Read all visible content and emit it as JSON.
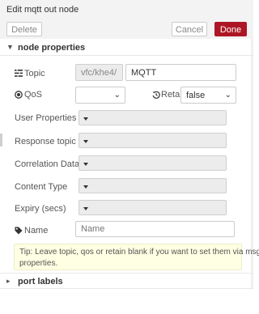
{
  "window": {
    "title": "Edit mqtt out node"
  },
  "toolbar": {
    "delete_label": "Delete",
    "cancel_label": "Cancel",
    "done_label": "Done"
  },
  "sections": {
    "node_properties": "node properties",
    "port_labels": "port labels"
  },
  "form": {
    "topic": {
      "label": "Topic",
      "prefix_value": "vfc/khe4/",
      "value": "MQTT"
    },
    "qos": {
      "label": "QoS",
      "value": ""
    },
    "retain": {
      "label": "Retain",
      "value": "false"
    },
    "user_properties": {
      "label": "User Properties"
    },
    "response_topic": {
      "label": "Response topic"
    },
    "correlation_data": {
      "label": "Correlation Data"
    },
    "content_type": {
      "label": "Content Type"
    },
    "expiry": {
      "label": "Expiry (secs)"
    },
    "name": {
      "label": "Name",
      "placeholder": "Name",
      "value": ""
    }
  },
  "tip": {
    "line1": "Tip: Leave topic, qos or retain blank if you want to set them via msg",
    "line2": "properties."
  },
  "colors": {
    "done_button": "#ad1625",
    "tip_background": "#ffffe3",
    "disabled_field": "#ececec"
  },
  "icons": {
    "topic": "tasks-icon",
    "qos": "dot-circle-icon",
    "retain": "history-icon",
    "name": "tag-icon"
  }
}
